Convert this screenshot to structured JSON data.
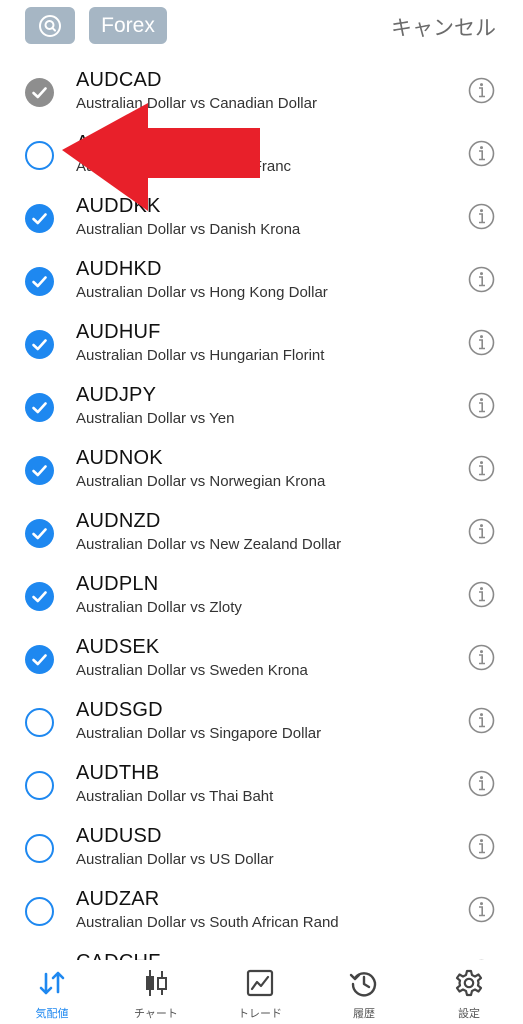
{
  "header": {
    "filter_label": "Forex",
    "cancel_label": "キャンセル",
    "search_icon": "search-icon"
  },
  "symbols": [
    {
      "symbol": "AUDCAD",
      "description": "Australian Dollar vs Canadian Dollar",
      "state": "disabled"
    },
    {
      "symbol": "AUDCHF",
      "description": "Australian Dollar vs Swiss Franc",
      "state": "unchecked"
    },
    {
      "symbol": "AUDDKK",
      "description": "Australian Dollar vs Danish Krona",
      "state": "checked"
    },
    {
      "symbol": "AUDHKD",
      "description": "Australian Dollar vs Hong Kong Dollar",
      "state": "checked"
    },
    {
      "symbol": "AUDHUF",
      "description": "Australian Dollar vs Hungarian Florint",
      "state": "checked"
    },
    {
      "symbol": "AUDJPY",
      "description": "Australian Dollar vs Yen",
      "state": "checked"
    },
    {
      "symbol": "AUDNOK",
      "description": "Australian Dollar vs Norwegian Krona",
      "state": "checked"
    },
    {
      "symbol": "AUDNZD",
      "description": "Australian Dollar vs New Zealand Dollar",
      "state": "checked"
    },
    {
      "symbol": "AUDPLN",
      "description": "Australian Dollar vs Zloty",
      "state": "checked"
    },
    {
      "symbol": "AUDSEK",
      "description": "Australian Dollar vs Sweden Krona",
      "state": "checked"
    },
    {
      "symbol": "AUDSGD",
      "description": "Australian Dollar vs Singapore Dollar",
      "state": "unchecked"
    },
    {
      "symbol": "AUDTHB",
      "description": "Australian Dollar vs Thai Baht",
      "state": "unchecked"
    },
    {
      "symbol": "AUDUSD",
      "description": "Australian Dollar vs US Dollar",
      "state": "unchecked"
    },
    {
      "symbol": "AUDZAR",
      "description": "Australian Dollar vs South African Rand",
      "state": "unchecked"
    },
    {
      "symbol": "CADCHF",
      "description": "",
      "state": "unchecked"
    }
  ],
  "tabs": [
    {
      "label": "気配値",
      "icon": "quotes-arrows-icon",
      "active": true
    },
    {
      "label": "チャート",
      "icon": "candlestick-icon",
      "active": false
    },
    {
      "label": "トレード",
      "icon": "trade-chart-icon",
      "active": false
    },
    {
      "label": "履歴",
      "icon": "history-clock-icon",
      "active": false
    },
    {
      "label": "設定",
      "icon": "gear-icon",
      "active": false
    }
  ],
  "colors": {
    "accent": "#1e88f0",
    "pill": "#a6b6c4",
    "arrow": "#e8202a",
    "disabled": "#8e8e8e"
  }
}
